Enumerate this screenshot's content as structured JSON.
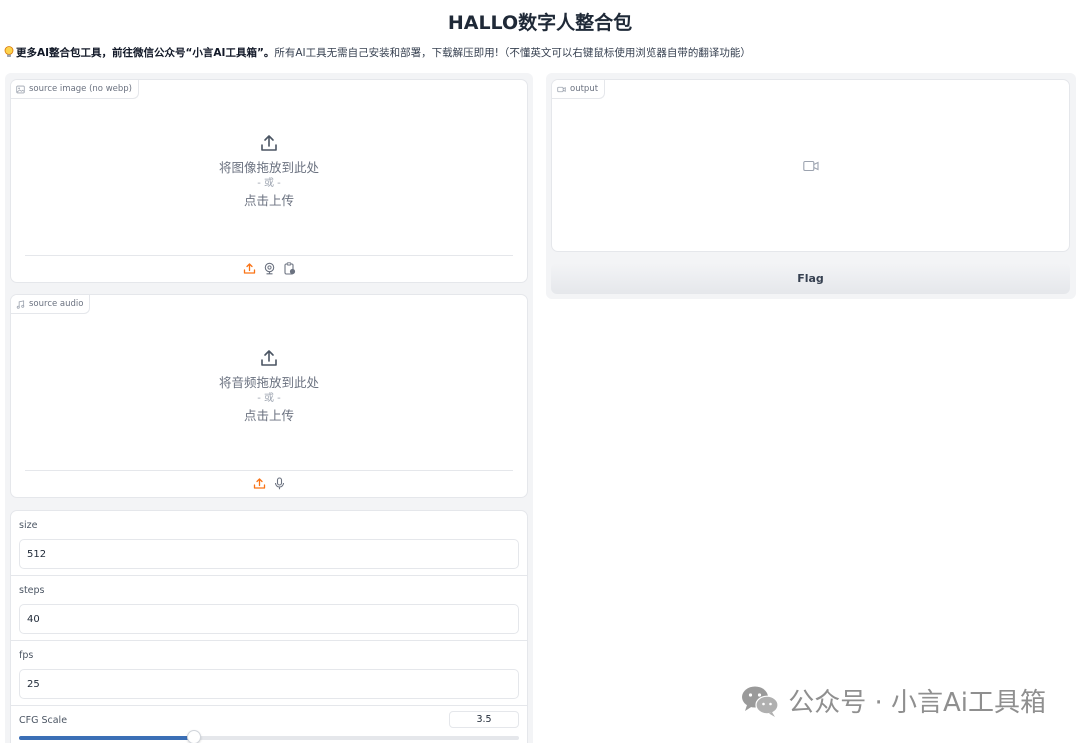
{
  "page": {
    "title": "HALLO数字人整合包"
  },
  "notice": {
    "bold": "更多AI整合包工具，前往微信公众号“小言AI工具箱”。",
    "rest": "所有AI工具无需自己安装和部署，下载解压即用!（不懂英文可以右键鼠标使用浏览器自带的翻译功能）"
  },
  "source_image": {
    "label": "source image (no webp)",
    "icon": "image-icon",
    "drop_text": "将图像拖放到此处",
    "or_text": "- 或 -",
    "click_text": "点击上传",
    "tools": [
      "upload-icon",
      "webcam-icon",
      "clipboard-icon"
    ]
  },
  "source_audio": {
    "label": "source audio",
    "icon": "music-icon",
    "drop_text": "将音频拖放到此处",
    "or_text": "- 或 -",
    "click_text": "点击上传",
    "tools": [
      "upload-icon",
      "microphone-icon"
    ]
  },
  "params": {
    "size": {
      "label": "size",
      "value": "512"
    },
    "steps": {
      "label": "steps",
      "value": "40"
    },
    "fps": {
      "label": "fps",
      "value": "25"
    },
    "cfg": {
      "label": "CFG Scale",
      "value": "3.5",
      "slider_fraction": 0.35
    }
  },
  "output": {
    "label": "output",
    "icon": "video-icon"
  },
  "flag_button": {
    "label": "Flag"
  },
  "watermark": {
    "text": "公众号 · 小言Ai工具箱",
    "icon": "wechat-icon"
  },
  "colors": {
    "accent_orange": "#f97316",
    "slider_blue": "#3b6fb6",
    "border": "#e5e7eb"
  }
}
